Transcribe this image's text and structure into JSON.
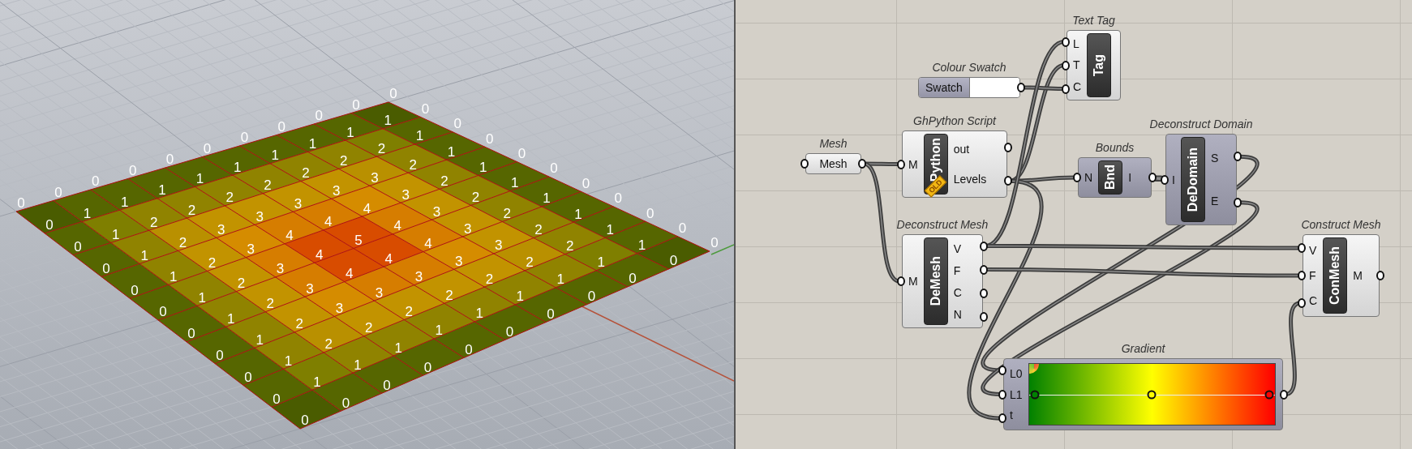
{
  "viewport": {
    "mesh": {
      "vertex_labels": [
        "0",
        "0",
        "0",
        "0",
        "0",
        "0",
        "0",
        "0",
        "0",
        "0",
        "0",
        "0",
        "1",
        "1",
        "1",
        "1",
        "1",
        "1",
        "1",
        "1",
        "1",
        "0",
        "0",
        "1",
        "2",
        "2",
        "2",
        "2",
        "2",
        "2",
        "2",
        "1",
        "0",
        "0",
        "1",
        "2",
        "3",
        "3",
        "3",
        "3",
        "3",
        "2",
        "1",
        "0",
        "0",
        "1",
        "2",
        "3",
        "4",
        "4",
        "4",
        "3",
        "2",
        "1",
        "0",
        "0",
        "1",
        "2",
        "3",
        "4",
        "5",
        "4",
        "3",
        "2",
        "1",
        "0",
        "0",
        "1",
        "2",
        "3",
        "4",
        "4",
        "4",
        "3",
        "2",
        "1",
        "0",
        "0",
        "1",
        "2",
        "3",
        "3",
        "3",
        "3",
        "3",
        "2",
        "1",
        "0",
        "0",
        "1",
        "2",
        "2",
        "2",
        "2",
        "2",
        "2",
        "2",
        "1",
        "0",
        "0",
        "1",
        "1",
        "1",
        "1",
        "1",
        "1",
        "1",
        "1",
        "1",
        "0",
        "0",
        "0",
        "0",
        "0",
        "0",
        "0",
        "0",
        "0",
        "0",
        "0",
        "0"
      ]
    }
  },
  "canvas": {
    "components": [
      {
        "kind": "param",
        "title": "Mesh",
        "name": "Mesh"
      },
      {
        "kind": "swatch",
        "title": "Colour Swatch",
        "name": "Swatch",
        "color": "#ffffff"
      },
      {
        "kind": "tag",
        "title": "Text Tag",
        "name": "Tag",
        "inputs": [
          "L",
          "T",
          "C"
        ]
      },
      {
        "kind": "component",
        "title": "GhPython Script",
        "name": "Python",
        "badge": "OLD",
        "inputs": [
          "M"
        ],
        "outputs": [
          "out",
          "Levels"
        ],
        "preview_hidden": false
      },
      {
        "kind": "component",
        "title": "Bounds",
        "name": "Bnd",
        "inputs": [
          "N"
        ],
        "outputs": [
          "I"
        ],
        "preview_hidden": true
      },
      {
        "kind": "component",
        "title": "Deconstruct Domain",
        "name": "DeDomain",
        "inputs": [
          "I"
        ],
        "outputs": [
          "S",
          "E"
        ],
        "preview_hidden": true
      },
      {
        "kind": "component",
        "title": "Deconstruct Mesh",
        "name": "DeMesh",
        "inputs": [
          "M"
        ],
        "outputs": [
          "V",
          "F",
          "C",
          "N"
        ],
        "preview_hidden": false
      },
      {
        "kind": "component",
        "title": "Construct Mesh",
        "name": "ConMesh",
        "inputs": [
          "V",
          "F",
          "C"
        ],
        "outputs": [
          "M"
        ],
        "preview_hidden": false
      },
      {
        "kind": "gradient",
        "title": "Gradient",
        "inputs": [
          "L0",
          "L1",
          "t"
        ],
        "stops": [
          {
            "color": "#008000"
          },
          {
            "color": "#ffff00"
          },
          {
            "color": "#ff0000"
          }
        ]
      }
    ]
  }
}
